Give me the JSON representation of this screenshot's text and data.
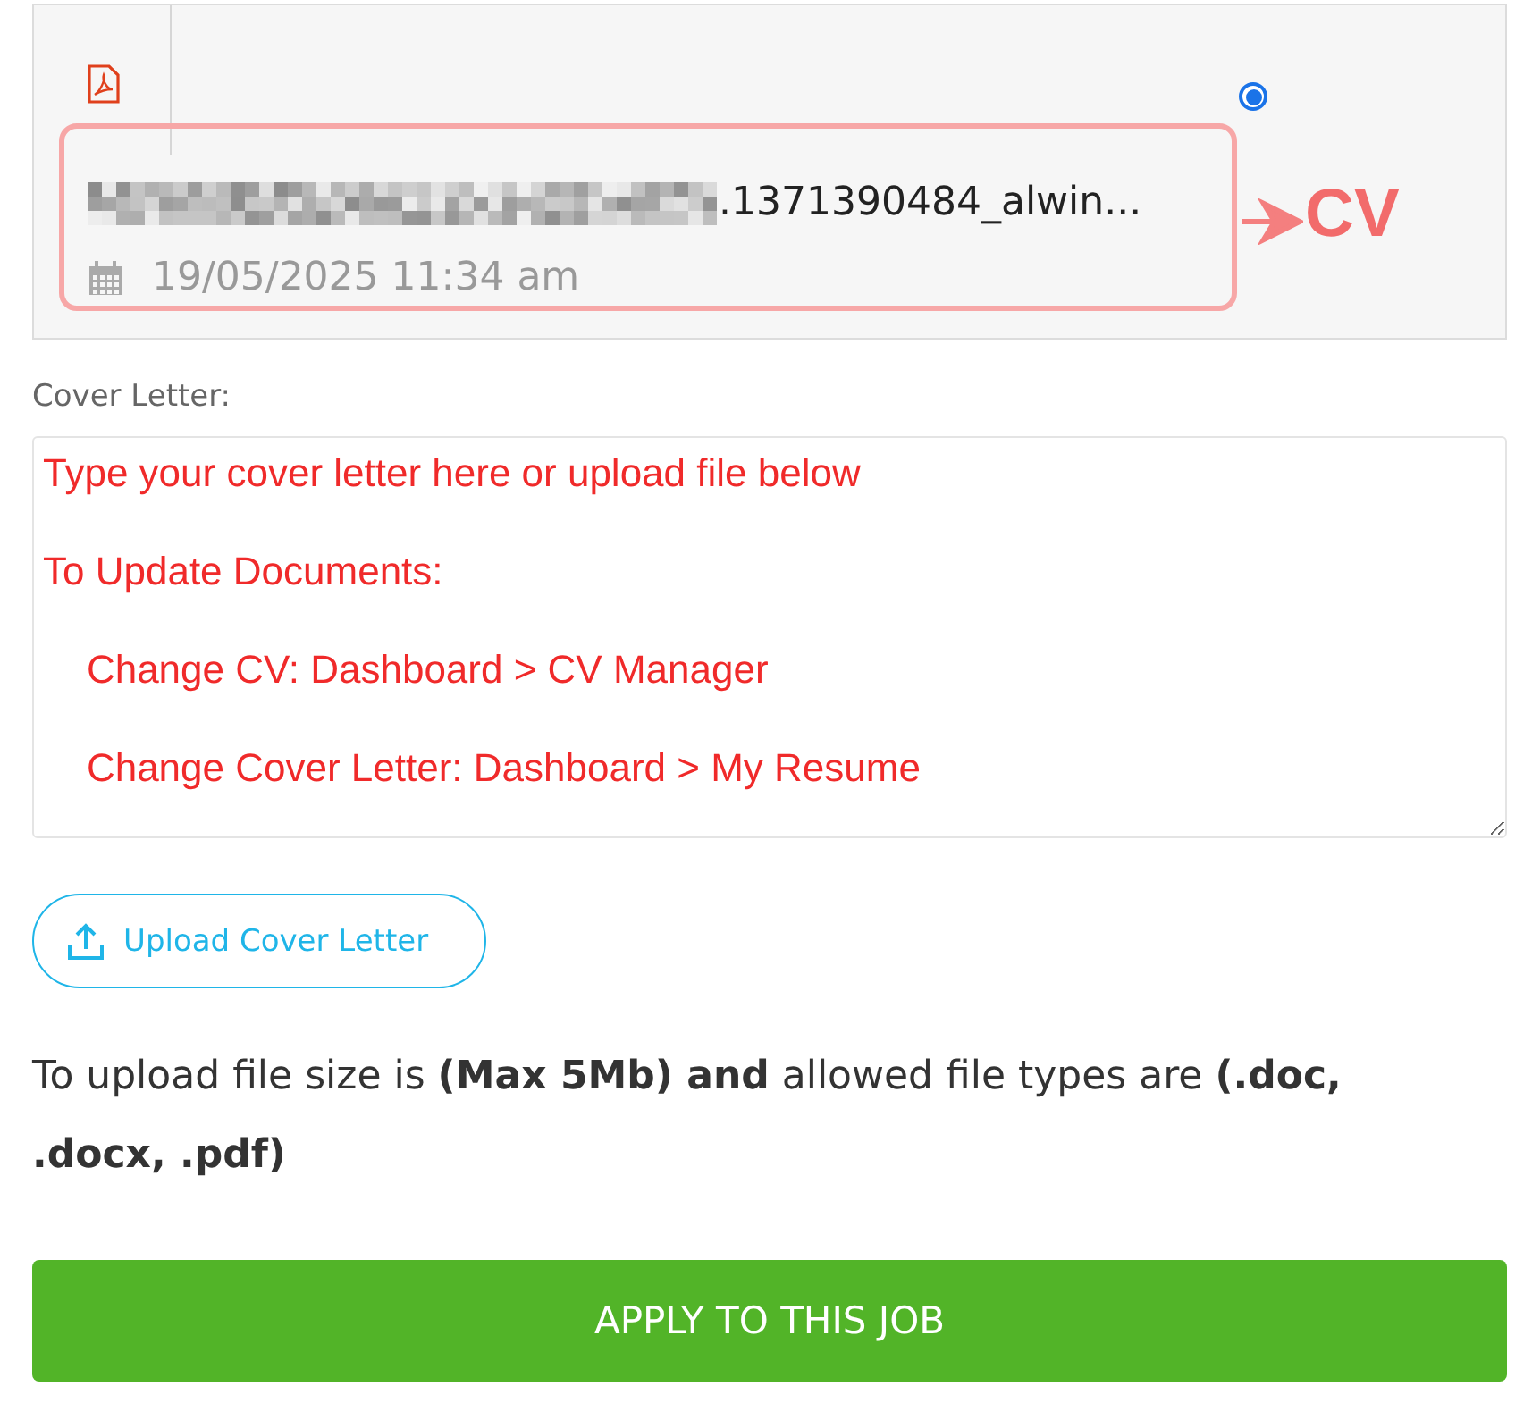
{
  "cv_file": {
    "filename_visible": ".1371390484_alwin...",
    "date": "19/05/2025 11:34 am",
    "selected": true,
    "annotation": "CV"
  },
  "cover_letter": {
    "label": "Cover Letter:",
    "lines": [
      "Type your cover letter here or upload file below",
      "To Update Documents:",
      "    Change CV: Dashboard > CV Manager",
      "    Change Cover Letter: Dashboard > My Resume"
    ]
  },
  "upload_button": "Upload Cover Letter",
  "note": "To upload file size is **(Max 5Mb) and** allowed file types are **(.doc, .docx, .pdf)**",
  "apply_button": "APPLY TO THIS JOB"
}
